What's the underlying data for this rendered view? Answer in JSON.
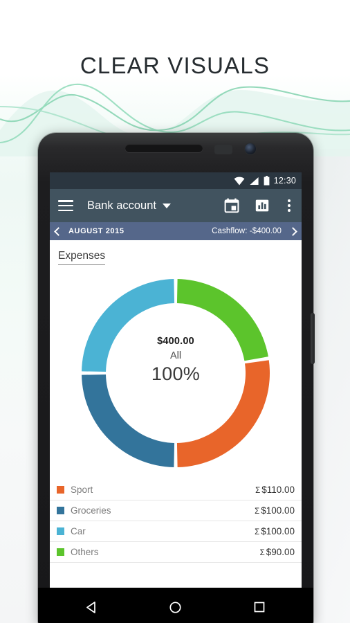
{
  "promo": {
    "headline": "CLEAR VISUALS",
    "accent_color": "#7fd3ad",
    "background_color": "#f1f8f5"
  },
  "phone": {
    "earpiece_icon": "speaker-grille",
    "camera_icon": "front-camera",
    "sensor_icon": "proximity-sensor"
  },
  "status_bar": {
    "time": "12:30",
    "icons": [
      "wifi-icon",
      "cellular-signal-icon",
      "battery-icon"
    ],
    "background": "#2b3640"
  },
  "app_bar": {
    "menu_icon": "hamburger-menu-icon",
    "account_name": "Bank account",
    "dropdown_icon": "chevron-down-icon",
    "actions": [
      "calendar-icon",
      "bar-chart-icon",
      "overflow-menu-icon"
    ],
    "background": "#41535f"
  },
  "period_bar": {
    "prev_icon": "chevron-left-icon",
    "period": "AUGUST 2015",
    "cashflow": "Cashflow: -$400.00",
    "next_icon": "chevron-right-icon",
    "background": "#55678a"
  },
  "tabs": [
    {
      "label": "Expenses",
      "active": true
    }
  ],
  "donut": {
    "total": "$400.00",
    "scope": "All",
    "percent": "100%"
  },
  "legend": {
    "rows": [
      {
        "name": "Sport",
        "amount": "$110.00",
        "sigma": "Σ",
        "color": "#e8652a"
      },
      {
        "name": "Groceries",
        "amount": "$100.00",
        "sigma": "Σ",
        "color": "#33749b"
      },
      {
        "name": "Car",
        "amount": "$100.00",
        "sigma": "Σ",
        "color": "#4bb3d4"
      },
      {
        "name": "Others",
        "amount": "$90.00",
        "sigma": "Σ",
        "color": "#5cc42c"
      }
    ]
  },
  "nav_bar": {
    "back_icon": "back-triangle-icon",
    "home_icon": "home-circle-icon",
    "recents_icon": "recents-square-icon"
  },
  "chart_data": {
    "type": "pie",
    "title": "Expenses",
    "subtitle": "AUGUST 2015",
    "categories": [
      "Others",
      "Sport",
      "Groceries",
      "Car"
    ],
    "values": [
      90,
      110,
      100,
      100
    ],
    "colors": [
      "#5cc42c",
      "#e8652a",
      "#33749b",
      "#4bb3d4"
    ],
    "total": 400,
    "currency": "$",
    "center_label": "All",
    "center_percent": 100,
    "donut": true,
    "start_angle_deg": 0,
    "direction": "clockwise",
    "legend": "bottom-list",
    "slice_percents": [
      22.5,
      27.5,
      25.0,
      25.0
    ]
  }
}
